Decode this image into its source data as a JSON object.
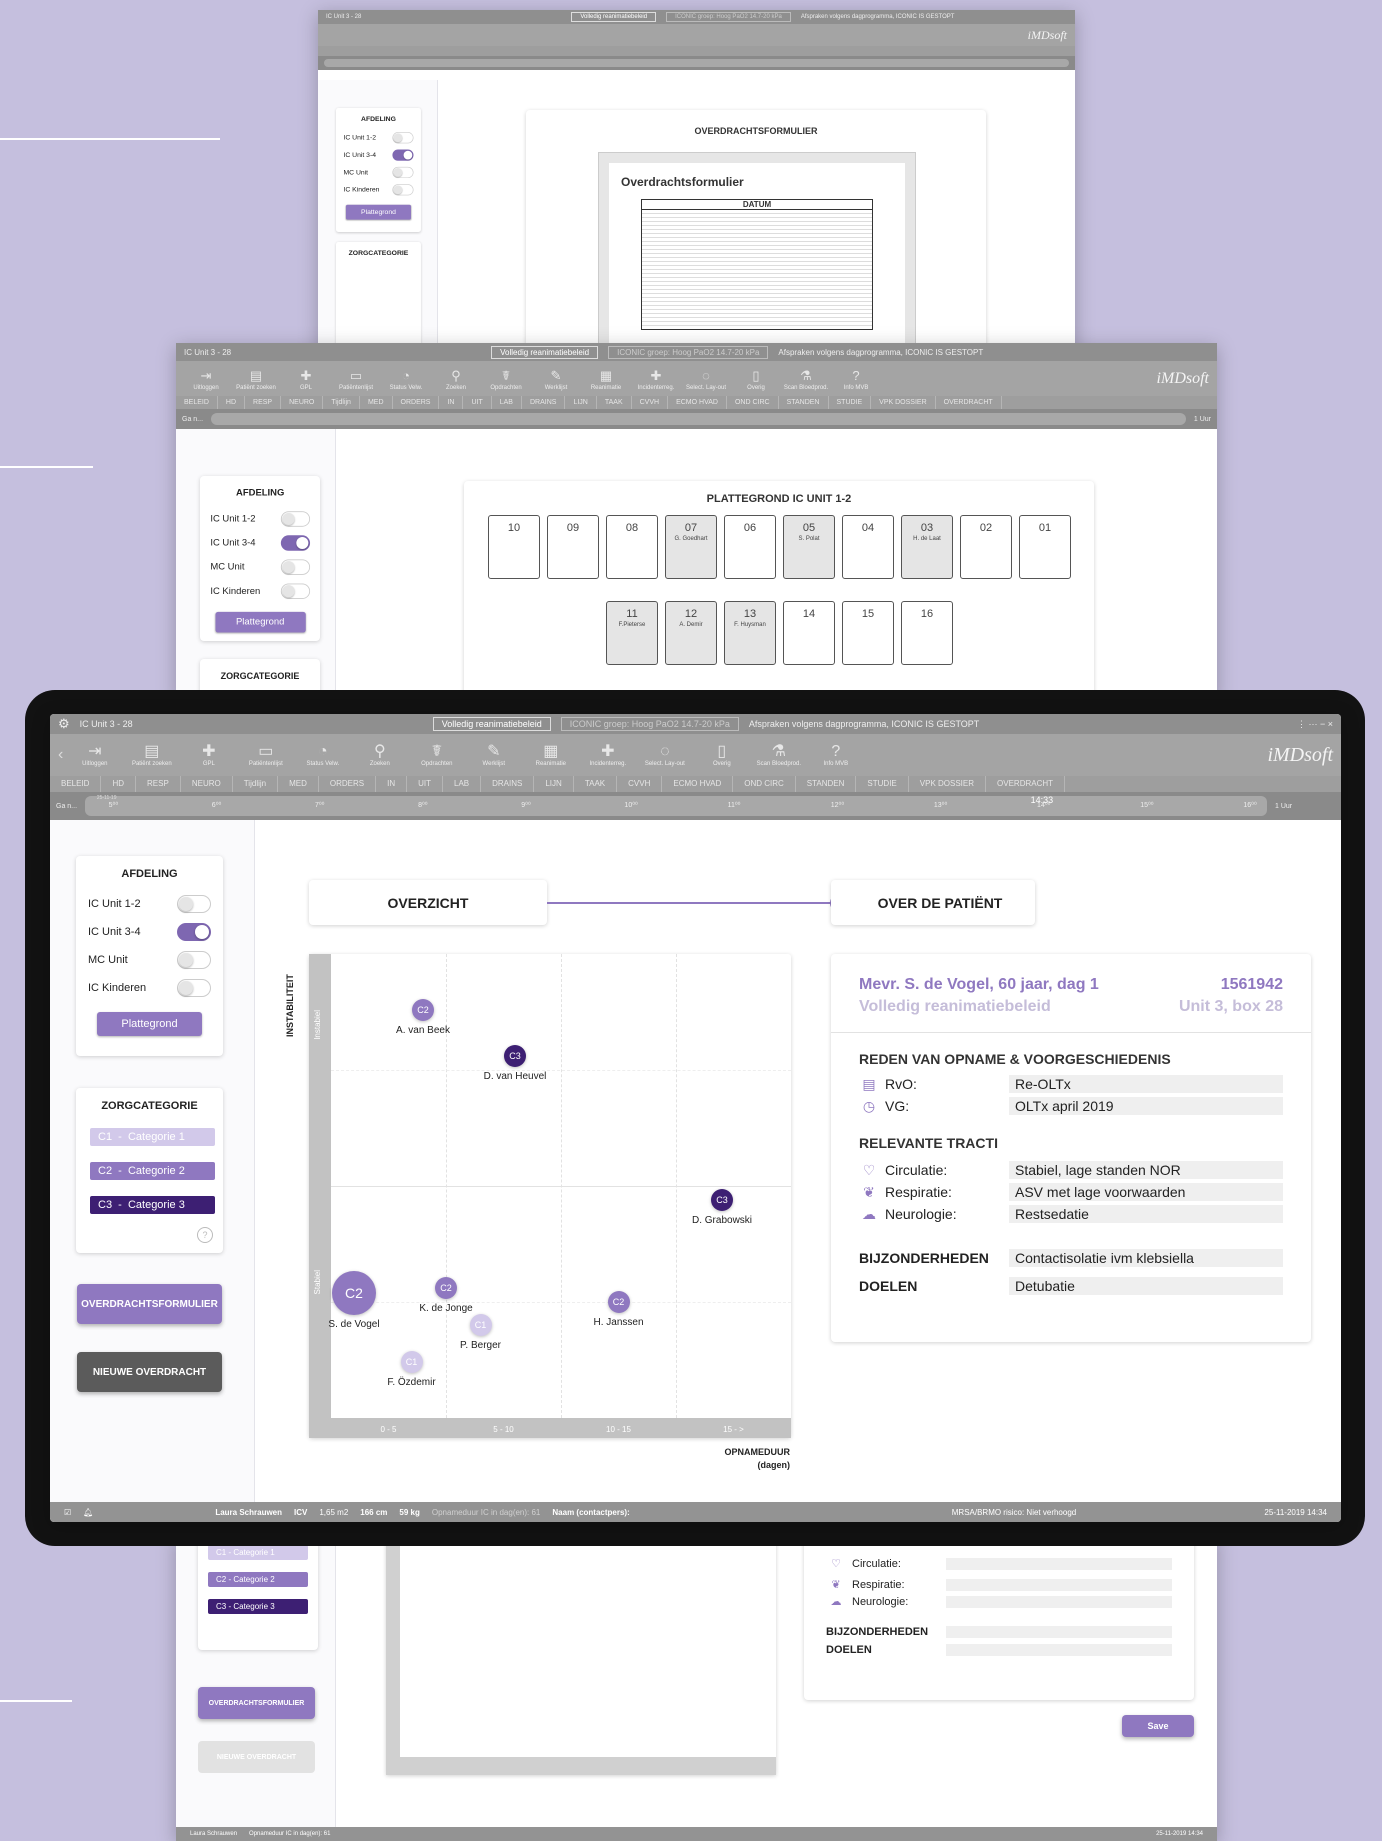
{
  "app": {
    "window_title": "IC Unit 3 - 28",
    "reanimatie": "Volledig reanimatiebeleid",
    "iconic": "ICONIC groep: Hoog PaO2 14.7-20 kPa",
    "afspraken": "Afspraken volgens dagprogramma, ICONIC IS GESTOPT",
    "logo": "iMDsoft",
    "toolbar": [
      {
        "label": "Uitloggen",
        "icon": "logout-icon"
      },
      {
        "label": "Patiënt zoeken",
        "icon": "patient-search-icon"
      },
      {
        "label": "GPL",
        "icon": "gpl-icon"
      },
      {
        "label": "Patiëntenlijst",
        "icon": "patient-list-icon"
      },
      {
        "label": "Status Velw.",
        "icon": "status-icon"
      },
      {
        "label": "Zoeken",
        "icon": "search-icon"
      },
      {
        "label": "Opdrachten",
        "icon": "orders-icon"
      },
      {
        "label": "Werklijst",
        "icon": "worklist-icon"
      },
      {
        "label": "Reanimatie",
        "icon": "reanimation-icon"
      },
      {
        "label": "Incidenterreg.",
        "icon": "incident-icon"
      },
      {
        "label": "Select. Lay-out",
        "icon": "layout-icon"
      },
      {
        "label": "Overig",
        "icon": "other-icon"
      },
      {
        "label": "Scan Bloedprod.",
        "icon": "scan-icon"
      },
      {
        "label": "Info MVB",
        "icon": "info-icon"
      }
    ],
    "tabs": [
      "BELEID",
      "HD",
      "RESP",
      "NEURO",
      "Tijdlijn",
      "MED",
      "ORDERS",
      "IN",
      "UIT",
      "LAB",
      "DRAINS",
      "LIJN",
      "TAAK",
      "CVVH",
      "ECMO HVAD",
      "OND CIRC",
      "STANDEN",
      "STUDIE",
      "VPK DOSSIER",
      "OVERDRACHT"
    ],
    "time_nav": "Ga n...",
    "time_marker": "14:33",
    "time_range": "1 Uur",
    "date_small": "25-11-19",
    "hours": [
      "5⁰⁰",
      "6⁰⁰",
      "7⁰⁰",
      "8⁰⁰",
      "9⁰⁰",
      "10⁰⁰",
      "11⁰⁰",
      "12⁰⁰",
      "13⁰⁰",
      "14⁰⁰",
      "15⁰⁰",
      "16⁰⁰"
    ]
  },
  "sidebar": {
    "afdeling_title": "AFDELING",
    "units": [
      {
        "label": "IC Unit 1-2",
        "on": false
      },
      {
        "label": "IC Unit 3-4",
        "on": true
      },
      {
        "label": "MC Unit",
        "on": false
      },
      {
        "label": "IC Kinderen",
        "on": false
      }
    ],
    "plattegrond_btn": "Plattegrond",
    "zorg_title": "ZORGCATEGORIE",
    "categories": [
      {
        "code": "C1",
        "label": "Categorie 1",
        "color": "#d2c9ea"
      },
      {
        "code": "C2",
        "label": "Categorie 2",
        "color": "#8f78c0"
      },
      {
        "code": "C3",
        "label": "Categorie 3",
        "color": "#3d1f73"
      }
    ],
    "help": "?",
    "overdracht_btn": "OVERDRACHTSFORMULIER",
    "nieuwe_btn": "NIEUWE OVERDRACHT"
  },
  "steps": {
    "step1": "OVERZICHT",
    "step2": "OVER DE PATIËNT"
  },
  "chart_data": {
    "type": "scatter",
    "ylabel": "INSTABILITEIT",
    "xlabel": "OPNAMEDUUR (dagen)",
    "y_bands": [
      "Instabiel",
      "Stabiel"
    ],
    "categories": [
      "0 - 5",
      "5 - 10",
      "10 - 15",
      "15 - >"
    ],
    "points": [
      {
        "name": "A. van Beek",
        "cat": "C2",
        "x": 4,
        "y": 0.88
      },
      {
        "name": "D. van Heuvel",
        "cat": "C3",
        "x": 8,
        "y": 0.78
      },
      {
        "name": "D. Grabowski",
        "cat": "C3",
        "x": 17,
        "y": 0.47
      },
      {
        "name": "S. de Vogel",
        "cat": "C2",
        "x": 1,
        "y": 0.27,
        "selected": true
      },
      {
        "name": "K. de Jonge",
        "cat": "C2",
        "x": 5,
        "y": 0.28
      },
      {
        "name": "H. Janssen",
        "cat": "C2",
        "x": 12.5,
        "y": 0.25
      },
      {
        "name": "P. Berger",
        "cat": "C1",
        "x": 6.5,
        "y": 0.2
      },
      {
        "name": "F. Özdemir",
        "cat": "C1",
        "x": 3.5,
        "y": 0.12
      }
    ]
  },
  "patient": {
    "name_line": "Mevr. S. de Vogel,  60 jaar, dag 1",
    "number": "1561942",
    "policy": "Volledig reanimatiebeleid",
    "location": "Unit 3, box 28",
    "reden_title": "REDEN VAN OPNAME & VOORGESCHIEDENIS",
    "rvo_label": "RvO:",
    "rvo": "Re-OLTx",
    "vg_label": "VG:",
    "vg": "OLTx april 2019",
    "tracti_title": "RELEVANTE TRACTI",
    "circ_label": "Circulatie:",
    "circ": "Stabiel, lage standen NOR",
    "resp_label": "Respiratie:",
    "resp": "ASV met lage voorwaarden",
    "neuro_label": "Neurologie:",
    "neuro": "Restsedatie",
    "bijz_label": "BIJZONDERHEDEN",
    "bijz": "Contactisolatie ivm klebsiella",
    "doel_label": "DOELEN",
    "doel": "Detubatie"
  },
  "statusbar": {
    "user": "Laura Schrauwen",
    "icv": "ICV",
    "m2": "1,65 m2",
    "cm": "166 cm",
    "kg": "59 kg",
    "opname": "Opnameduur IC in dag(en): 61",
    "contact": "Naam (contactpers):",
    "mrsa": "MRSA/BRMO risico: Niet verhoogd",
    "datetime": "25-11-2019 14:34"
  },
  "screen1": {
    "form_title": "OVERDRACHTSFORMULIER",
    "doc_title": "Overdrachtsformulier",
    "doc_col": "DATUM"
  },
  "screen2": {
    "plan_title": "PLATTEGROND IC UNIT 1-2",
    "beds_row1": [
      {
        "n": "10",
        "name": ""
      },
      {
        "n": "09",
        "name": ""
      },
      {
        "n": "08",
        "name": ""
      },
      {
        "n": "07",
        "name": "G. Goedhart"
      },
      {
        "n": "06",
        "name": ""
      },
      {
        "n": "05",
        "name": "S. Polat"
      },
      {
        "n": "04",
        "name": ""
      },
      {
        "n": "03",
        "name": "H. de Laat"
      },
      {
        "n": "02",
        "name": ""
      },
      {
        "n": "01",
        "name": ""
      }
    ],
    "beds_row2": [
      {
        "n": "11",
        "name": "F.Pieterse"
      },
      {
        "n": "12",
        "name": "A. Demir"
      },
      {
        "n": "13",
        "name": "F. Huysman"
      },
      {
        "n": "14",
        "name": ""
      },
      {
        "n": "15",
        "name": ""
      },
      {
        "n": "16",
        "name": ""
      }
    ]
  },
  "screen4": {
    "tracti_title": "RELEVANTE TRACTI",
    "save_btn": "Save"
  }
}
